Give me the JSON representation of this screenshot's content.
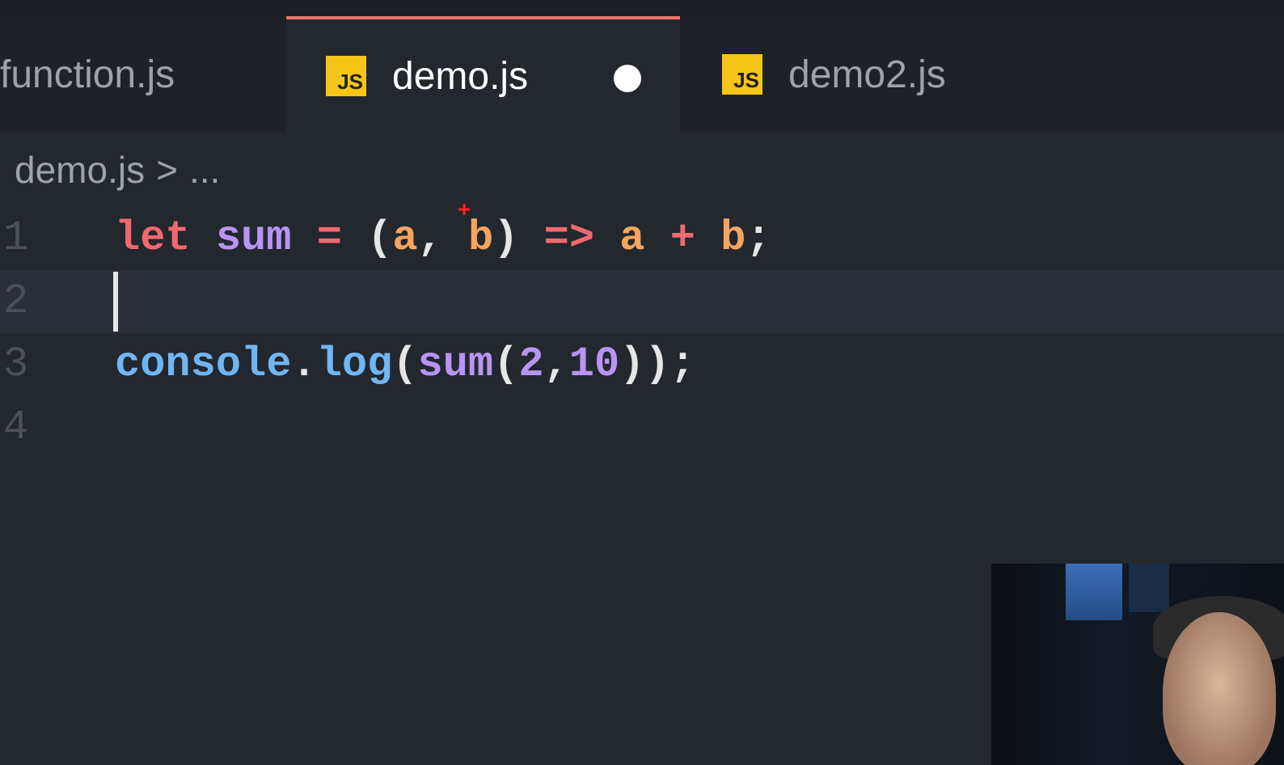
{
  "tabs": [
    {
      "label": "function.js",
      "active": false
    },
    {
      "label": "demo.js",
      "active": true,
      "icon": "js-file-icon",
      "modified": true
    },
    {
      "label": "demo2.js",
      "active": false,
      "icon": "js-file-icon"
    }
  ],
  "js_icon_text": "JS",
  "breadcrumb": {
    "file": "demo.js",
    "separator": ">",
    "more": "..."
  },
  "editor": {
    "lines": [
      {
        "number": "1",
        "tokens": [
          [
            "kw",
            "let"
          ],
          [
            "pl",
            " "
          ],
          [
            "fn",
            "sum"
          ],
          [
            "pl",
            " "
          ],
          [
            "op",
            "="
          ],
          [
            "pl",
            " ("
          ],
          [
            "pa",
            "a"
          ],
          [
            "pl",
            ", "
          ],
          [
            "pa",
            "b"
          ],
          [
            "pl",
            ") "
          ],
          [
            "op",
            "=>"
          ],
          [
            "pl",
            " "
          ],
          [
            "pa",
            "a"
          ],
          [
            "pl",
            " "
          ],
          [
            "op",
            "+"
          ],
          [
            "pl",
            " "
          ],
          [
            "pa",
            "b"
          ],
          [
            "pl",
            ";"
          ]
        ]
      },
      {
        "number": "2",
        "tokens": [],
        "current": true
      },
      {
        "number": "3",
        "tokens": [
          [
            "ob",
            "console"
          ],
          [
            "pl",
            "."
          ],
          [
            "ob",
            "log"
          ],
          [
            "pl",
            "("
          ],
          [
            "fn",
            "sum"
          ],
          [
            "pl",
            "("
          ],
          [
            "nu",
            "2"
          ],
          [
            "pl",
            ","
          ],
          [
            "nu",
            "10"
          ],
          [
            "pl",
            "));"
          ]
        ]
      },
      {
        "number": "4",
        "tokens": []
      }
    ]
  },
  "colors": {
    "accent": "#f07466",
    "keyword": "#f2686f",
    "function": "#b894f5",
    "param": "#f5a55e",
    "object": "#6fb6f5",
    "js_icon": "#f5c518"
  }
}
